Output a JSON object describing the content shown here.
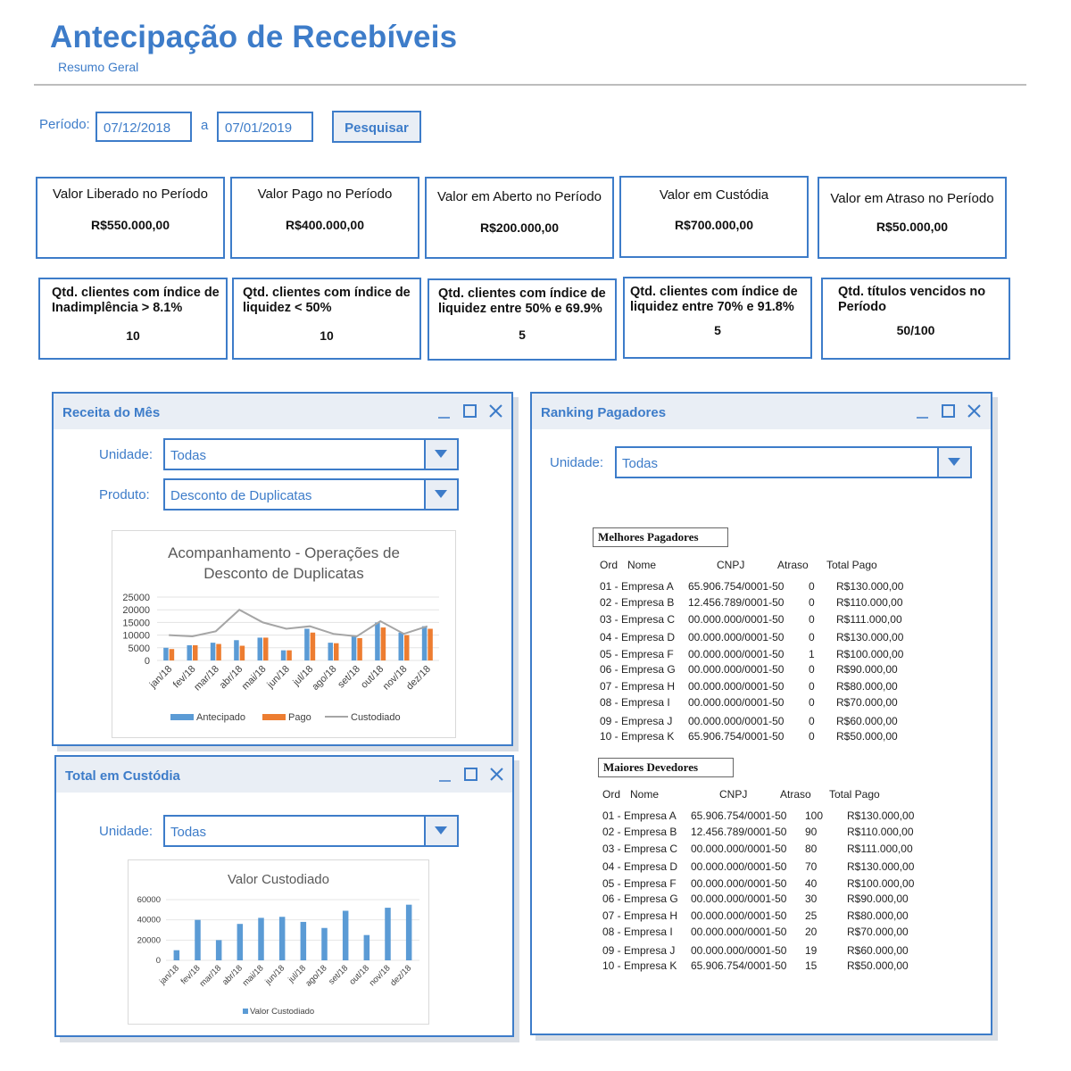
{
  "header": {
    "title": "Antecipação de Recebíveis",
    "subtitle": "Resumo Geral"
  },
  "filter": {
    "period_label": "Período:",
    "start": "07/12/2018",
    "sep": "a",
    "end": "07/01/2019",
    "search_button": "Pesquisar"
  },
  "kpis": [
    {
      "label": "Valor Liberado no Período",
      "value": "R$550.000,00"
    },
    {
      "label": "Valor Pago no Período",
      "value": "R$400.000,00"
    },
    {
      "label": "Valor em Aberto no Período",
      "value": "R$200.000,00"
    },
    {
      "label": "Valor em Custódia",
      "value": "R$700.000,00"
    },
    {
      "label": "Valor em Atraso no Período",
      "value": "R$50.000,00"
    }
  ],
  "counters": [
    {
      "line1": "Qtd. clientes com índice de",
      "line2": "Inadimplência > 8.1%",
      "value": "10"
    },
    {
      "line1": "Qtd. clientes com índice de",
      "line2": "liquidez < 50%",
      "value": "10"
    },
    {
      "line1": "Qtd. clientes com índice de",
      "line2": "liquidez entre 50% e 69.9%",
      "value": "5"
    },
    {
      "line1": "Qtd. clientes com índice de",
      "line2": "liquidez entre 70% e 91.8%",
      "value": "5"
    },
    {
      "line1": "Qtd. títulos vencidos no",
      "line2": "Período",
      "value": "50/100"
    }
  ],
  "receita": {
    "title": "Receita do Mês",
    "unidade_label": "Unidade:",
    "unidade_value": "Todas",
    "produto_label": "Produto:",
    "produto_value": "Desconto de Duplicatas",
    "chart_title_1": "Acompanhamento - Operações de",
    "chart_title_2": "Desconto de Duplicatas"
  },
  "custodia": {
    "title": "Total em Custódia",
    "unidade_label": "Unidade:",
    "unidade_value": "Todas",
    "chart_title": "Valor Custodiado"
  },
  "ranking": {
    "title": "Ranking Pagadores",
    "unidade_label": "Unidade:",
    "unidade_value": "Todas",
    "best_title": "Melhores Pagadores",
    "worst_title": "Maiores Devedores",
    "headers": [
      "Ord",
      "Nome",
      "CNPJ",
      "Atraso",
      "Total Pago"
    ],
    "best_rows": [
      [
        "01 - Empresa A",
        "65.906.754/0001-50",
        "0",
        "R$130.000,00"
      ],
      [
        "02 - Empresa B",
        "12.456.789/0001-50",
        "0",
        "R$110.000,00"
      ],
      [
        "03 - Empresa C",
        "00.000.000/0001-50",
        "0",
        "R$111.000,00"
      ],
      [
        "04 - Empresa D",
        "00.000.000/0001-50",
        "0",
        "R$130.000,00"
      ],
      [
        "05 - Empresa F",
        "00.000.000/0001-50",
        "1",
        "R$100.000,00"
      ],
      [
        "06 - Empresa G",
        "00.000.000/0001-50",
        "0",
        "R$90.000,00"
      ],
      [
        "07 - Empresa H",
        "00.000.000/0001-50",
        "0",
        "R$80.000,00"
      ],
      [
        "08 - Empresa I",
        "00.000.000/0001-50",
        "0",
        "R$70.000,00"
      ],
      [
        "09 - Empresa J",
        "00.000.000/0001-50",
        "0",
        "R$60.000,00"
      ],
      [
        "10 - Empresa K",
        "65.906.754/0001-50",
        "0",
        "R$50.000,00"
      ]
    ],
    "worst_rows": [
      [
        "01 - Empresa A",
        "65.906.754/0001-50",
        "100",
        "R$130.000,00"
      ],
      [
        "02 - Empresa B",
        "12.456.789/0001-50",
        "90",
        "R$110.000,00"
      ],
      [
        "03 - Empresa C",
        "00.000.000/0001-50",
        "80",
        "R$111.000,00"
      ],
      [
        "04 - Empresa D",
        "00.000.000/0001-50",
        "70",
        "R$130.000,00"
      ],
      [
        "05 - Empresa F",
        "00.000.000/0001-50",
        "40",
        "R$100.000,00"
      ],
      [
        "06 - Empresa G",
        "00.000.000/0001-50",
        "30",
        "R$90.000,00"
      ],
      [
        "07 - Empresa H",
        "00.000.000/0001-50",
        "25",
        "R$80.000,00"
      ],
      [
        "08 - Empresa I",
        "00.000.000/0001-50",
        "20",
        "R$70.000,00"
      ],
      [
        "09 - Empresa J",
        "00.000.000/0001-50",
        "19",
        "R$60.000,00"
      ],
      [
        "10 - Empresa K",
        "65.906.754/0001-50",
        "15",
        "R$50.000,00"
      ]
    ]
  },
  "colors": {
    "accent": "#3d7cc9",
    "series_antecipado": "#5b9bd5",
    "series_pago": "#ed7d31",
    "series_custodiado": "#a5a5a5"
  },
  "chart_data": [
    {
      "type": "bar",
      "title": "Acompanhamento - Operações de Desconto de Duplicatas",
      "categories": [
        "jan/18",
        "fev/18",
        "mar/18",
        "abr/18",
        "mai/18",
        "jun/18",
        "jul/18",
        "ago/18",
        "set/18",
        "out/18",
        "nov/18",
        "dez/18"
      ],
      "series": [
        {
          "name": "Antecipado",
          "type": "bar",
          "values": [
            5000,
            6000,
            7000,
            8000,
            9000,
            4000,
            12500,
            7000,
            9500,
            15000,
            11000,
            13500
          ]
        },
        {
          "name": "Pago",
          "type": "bar",
          "values": [
            4500,
            6000,
            6500,
            5800,
            9000,
            4000,
            11000,
            6800,
            8800,
            13000,
            10000,
            12500
          ]
        },
        {
          "name": "Custodiado",
          "type": "line",
          "values": [
            10000,
            9500,
            11500,
            20000,
            15000,
            12500,
            13500,
            10500,
            9500,
            15500,
            10500,
            13500
          ]
        }
      ],
      "ylim": [
        0,
        25000
      ],
      "yticks": [
        "25000",
        "20000",
        "15000",
        "10000",
        "5000",
        "0"
      ],
      "legend": "bottom",
      "grid": true
    },
    {
      "type": "bar",
      "title": "Valor Custodiado",
      "categories": [
        "jan/18",
        "fev/18",
        "mar/18",
        "abr/18",
        "mai/18",
        "jun/18",
        "jul/18",
        "ago/18",
        "set/18",
        "out/18",
        "nov/18",
        "dez/18"
      ],
      "series": [
        {
          "name": "Valor Custodiado",
          "values": [
            10000,
            40000,
            20000,
            36000,
            42000,
            43000,
            38000,
            32000,
            49000,
            25000,
            52000,
            55000
          ]
        }
      ],
      "ylim": [
        0,
        60000
      ],
      "yticks": [
        "60000",
        "40000",
        "20000",
        "0"
      ],
      "legend": "bottom",
      "grid": true
    }
  ]
}
